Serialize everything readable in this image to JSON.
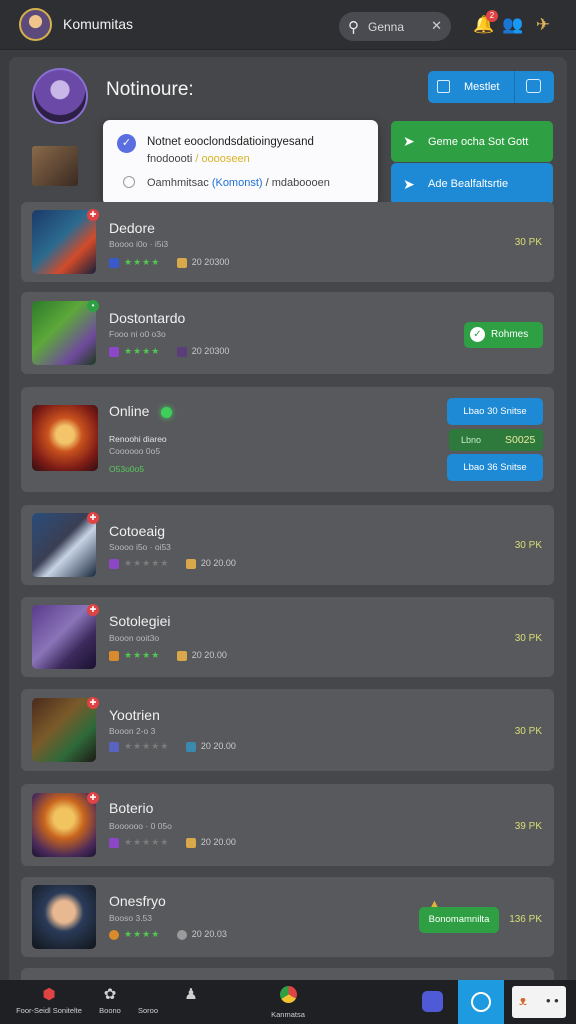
{
  "topbar": {
    "title": "Komumitas",
    "search_text": "Genna",
    "notif_count": "2"
  },
  "hero": {
    "title": "Notinoure:",
    "btn_primary": "Mestlet",
    "btn_green": "Geme ocha Sot Gott",
    "btn_blue_wide": "Ade Bealfaltsrtie"
  },
  "popup": {
    "line1": "Notnet eooclondsdatioingyesand",
    "line2_prefix": "fnodoooti",
    "line2_highlight": "/ ooooseen",
    "line3_prefix": "Oamhmitsac",
    "line3_link": "(Komonst)",
    "line3_suffix": "/ mdaboooen"
  },
  "games": [
    {
      "title": "Dedore",
      "sub": "Boooo i0o · i5i3",
      "date": "20 20300",
      "right": "30 PK",
      "thumb": "blue"
    },
    {
      "title": "Dostontardo",
      "sub": "Fooo ni o0 o3o",
      "date": "20 20300",
      "right_button": "Rohmes",
      "thumb": "green"
    },
    {
      "title": "Online",
      "sub": "Renoohi diareo",
      "sub2": "Coooooo 0o5",
      "meta_green": "O53o0o5",
      "btn_top": "Lbao 30 Snitse",
      "inline_text": "Lbno",
      "inline_value": "S0025",
      "btn_bottom": "Lbao 36 Snitse",
      "thumb": "red"
    },
    {
      "title": "Cotoeaig",
      "sub": "Soooo i5o · oi53",
      "date": "20 20.00",
      "right": "30 PK",
      "thumb": "hood"
    },
    {
      "title": "Sotolegiei",
      "sub": "Booon ooit3o",
      "date": "20 20.00",
      "right": "30 PK",
      "thumb": "purple"
    },
    {
      "title": "Yootrien",
      "sub": "Booon 2-o 3",
      "date": "20 20.00",
      "right": "30 PK",
      "thumb": "forest"
    },
    {
      "title": "Boterio",
      "sub": "Boooooo · 0 05o",
      "date": "20 20.00",
      "right": "39 PK",
      "thumb": "orange"
    },
    {
      "title": "Onesfryo",
      "sub": "Booso 3.53",
      "date": "20 20.03",
      "right_button": "Bonomamnilta",
      "right": "136 PK",
      "thumb": "boy"
    }
  ],
  "bottom_nav": {
    "item1": "Foor-Seidl Sonitelte",
    "item2": "Boono",
    "item3": "Soroo",
    "item4": "Kanmatsa"
  },
  "colors": {
    "accent_blue": "#1e8ad6",
    "accent_green": "#2ea043",
    "badge_red": "#e04343"
  }
}
